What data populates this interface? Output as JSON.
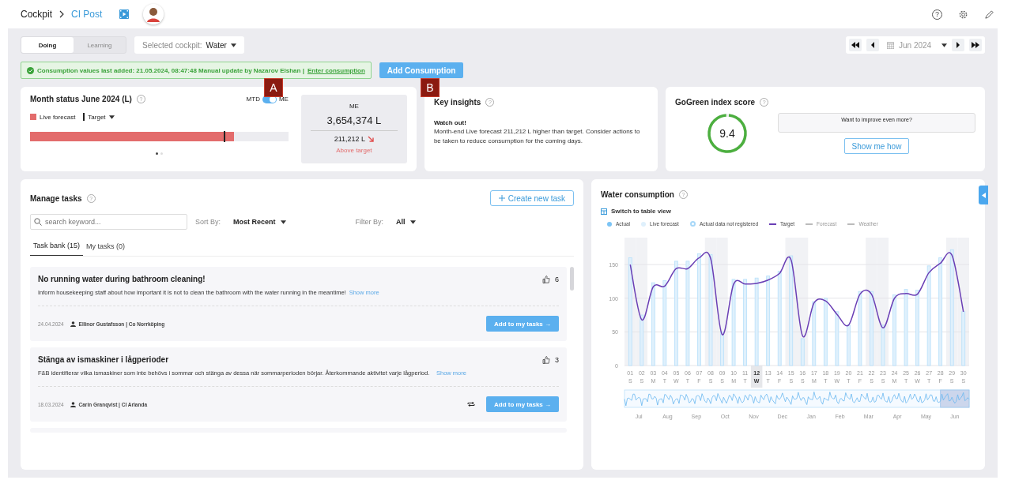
{
  "breadcrumb": [
    {
      "label": "Cockpit",
      "kind": "text"
    },
    {
      "label": "CI Post",
      "kind": "link"
    }
  ],
  "header_help": "?",
  "mode_tabs": [
    {
      "label": "Doing",
      "selected": true
    },
    {
      "label": "Learning",
      "selected": false
    }
  ],
  "cockpit_select": {
    "label": "Selected cockpit:",
    "value": "Water"
  },
  "date_nav": {
    "value": "Jun 2024"
  },
  "notice": {
    "text": "Consumption values last added: 21.05.2024, 08:47:48 Manual update by Nazarov Elshan |",
    "link": "Enter consumption"
  },
  "add_button": "Add Consumption",
  "markers": [
    "A",
    "B"
  ],
  "month_status": {
    "title": "Month status June 2024 (L)",
    "help": "?",
    "toggle": {
      "left": "MTD",
      "right": "ME",
      "on": true
    },
    "legend": [
      {
        "label": "Live forecast",
        "kind": "swatch"
      },
      {
        "label": "Target",
        "kind": "dropdown"
      }
    ],
    "forecast": {
      "level": 0.79
    },
    "target": {
      "level": 0.75
    },
    "pages": [
      {
        "selected": true
      },
      {
        "selected": false
      }
    ],
    "summary": {
      "label": "ME",
      "total": "3,654,374 L",
      "difference": "211,212 L",
      "status": "Above target"
    }
  },
  "key_insights": {
    "title": "Key insights",
    "help": "?",
    "heading": "Watch out!",
    "text": "Month-end Live forecast 211,212 L higher than target. Consider actions to be taken to reduce consumption for the coming days."
  },
  "gogreen": {
    "title": "GoGreen index score",
    "help": "?",
    "score": "9.4",
    "level": 0.97,
    "prompt": "Want to improve even more?",
    "button": "Show me how"
  },
  "tasks": {
    "title": "Manage tasks",
    "help": "?",
    "create_button": "Create new task",
    "search": {
      "placeholder": "search keyword..."
    },
    "sort": {
      "label": "Sort By:",
      "value": "Most Recent"
    },
    "filter": {
      "label": "Filter By:",
      "value": "All"
    },
    "tabs": [
      {
        "label": "Task bank (15)",
        "selected": true
      },
      {
        "label": "My tasks (0)",
        "selected": false
      }
    ],
    "items": [
      {
        "title": "No running water during bathroom cleaning!",
        "text": "Inform housekeeping staff about how important it is not to clean the bathroom with the water running in the meantime!",
        "show_more": "Show more",
        "likes": "6",
        "date": "24.04.2024",
        "author": "Ellinor Gustafsson | Co Norrköping",
        "recurring": false,
        "button": "Add to my tasks →"
      },
      {
        "title": "Stänga av ismaskiner i lågperioder",
        "text": "F&B identifierar vilka ismaskiner som inte behövs i sommar och stänga av dessa när sommarperioden börjar. Återkommande aktivitet varje lågperiod.",
        "show_more": "Show more",
        "likes": "3",
        "date": "18.03.2024",
        "author": "Carin Granqvist | CI Arlanda",
        "recurring": true,
        "button": "Add to my tasks →"
      }
    ]
  },
  "water": {
    "title": "Water consumption",
    "help": "?",
    "switch_label": "Switch to table view",
    "legend": [
      {
        "label": "Actual",
        "kind": "dot",
        "color": "#7cc4f5",
        "disabled": false
      },
      {
        "kind": "series",
        "disabled": false
      },
      {
        "label": "Actual data not registered",
        "kind": "ring",
        "color": "#a8d8f8",
        "disabled": false
      },
      {
        "kind": "series",
        "disabled": false
      },
      {
        "label": "Forecast",
        "kind": "line",
        "color": "#bbbbbb",
        "disabled": true
      },
      {
        "label": "Weather",
        "kind": "line",
        "color": "#bbbbbb",
        "disabled": true
      }
    ],
    "chart_data": {
      "type": "bar",
      "categories": [
        "01",
        "02",
        "03",
        "04",
        "05",
        "06",
        "07",
        "08",
        "09",
        "10",
        "11",
        "12",
        "13",
        "14",
        "15",
        "16",
        "17",
        "18",
        "19",
        "20",
        "21",
        "22",
        "23",
        "24",
        "25",
        "26",
        "27",
        "28",
        "29",
        "30"
      ],
      "series": [
        {
          "name": "Live forecast",
          "color": "#dff0fc",
          "values": [
            160,
            75,
            123,
            126,
            155,
            155,
            166,
            165,
            50,
            128,
            128,
            130,
            133,
            140,
            163,
            40,
            95,
            100,
            80,
            60,
            110,
            110,
            60,
            105,
            113,
            112,
            148,
            160,
            172,
            80
          ]
        },
        {
          "name": "Target",
          "type": "line",
          "color": "#6a3fb5",
          "values": [
            150,
            68,
            117,
            118,
            144,
            144,
            160,
            159,
            46,
            121,
            121,
            122,
            127,
            137,
            157,
            44,
            93,
            96,
            76,
            60,
            106,
            106,
            56,
            100,
            107,
            106,
            138,
            152,
            164,
            80
          ]
        }
      ],
      "ylim": [
        0,
        190
      ],
      "yticks": [
        0,
        50,
        100,
        150
      ],
      "grid": true
    },
    "x_labels": [
      {
        "weekday": "S",
        "weekend": true,
        "selected": false
      },
      {
        "weekday": "S",
        "weekend": true,
        "selected": false
      },
      {
        "weekday": "M",
        "weekend": false,
        "selected": false
      },
      {
        "weekday": "T",
        "weekend": false,
        "selected": false
      },
      {
        "weekday": "W",
        "weekend": false,
        "selected": false
      },
      {
        "weekday": "T",
        "weekend": false,
        "selected": false
      },
      {
        "weekday": "F",
        "weekend": false,
        "selected": false
      },
      {
        "weekday": "S",
        "weekend": true,
        "selected": false
      },
      {
        "weekday": "S",
        "weekend": true,
        "selected": false
      },
      {
        "weekday": "M",
        "weekend": false,
        "selected": false
      },
      {
        "weekday": "T",
        "weekend": false,
        "selected": false
      },
      {
        "weekday": "W",
        "weekend": false,
        "selected": true
      },
      {
        "weekday": "T",
        "weekend": false,
        "selected": false
      },
      {
        "weekday": "F",
        "weekend": false,
        "selected": false
      },
      {
        "weekday": "S",
        "weekend": true,
        "selected": false
      },
      {
        "weekday": "S",
        "weekend": true,
        "selected": false
      },
      {
        "weekday": "M",
        "weekend": false,
        "selected": false
      },
      {
        "weekday": "T",
        "weekend": false,
        "selected": false
      },
      {
        "weekday": "W",
        "weekend": false,
        "selected": false
      },
      {
        "weekday": "T",
        "weekend": false,
        "selected": false
      },
      {
        "weekday": "F",
        "weekend": false,
        "selected": false
      },
      {
        "weekday": "S",
        "weekend": true,
        "selected": false
      },
      {
        "weekday": "S",
        "weekend": true,
        "selected": false
      },
      {
        "weekday": "M",
        "weekend": false,
        "selected": false
      },
      {
        "weekday": "T",
        "weekend": false,
        "selected": false
      },
      {
        "weekday": "W",
        "weekend": false,
        "selected": false
      },
      {
        "weekday": "T",
        "weekend": false,
        "selected": false
      },
      {
        "weekday": "F",
        "weekend": false,
        "selected": false
      },
      {
        "weekday": "S",
        "weekend": true,
        "selected": false
      },
      {
        "weekday": "S",
        "weekend": true,
        "selected": false
      }
    ],
    "navigator_months": [
      {
        "label": "Jul",
        "selected": false
      },
      {
        "label": "Aug",
        "selected": false
      },
      {
        "label": "Sep",
        "selected": false
      },
      {
        "label": "Oct",
        "selected": false
      },
      {
        "label": "Nov",
        "selected": false
      },
      {
        "label": "Dec",
        "selected": false
      },
      {
        "label": "Jan",
        "selected": false
      },
      {
        "label": "Feb",
        "selected": false
      },
      {
        "label": "Mar",
        "selected": false
      },
      {
        "label": "Apr",
        "selected": false
      },
      {
        "label": "May",
        "selected": false
      },
      {
        "label": "Jun",
        "selected": true
      }
    ]
  }
}
